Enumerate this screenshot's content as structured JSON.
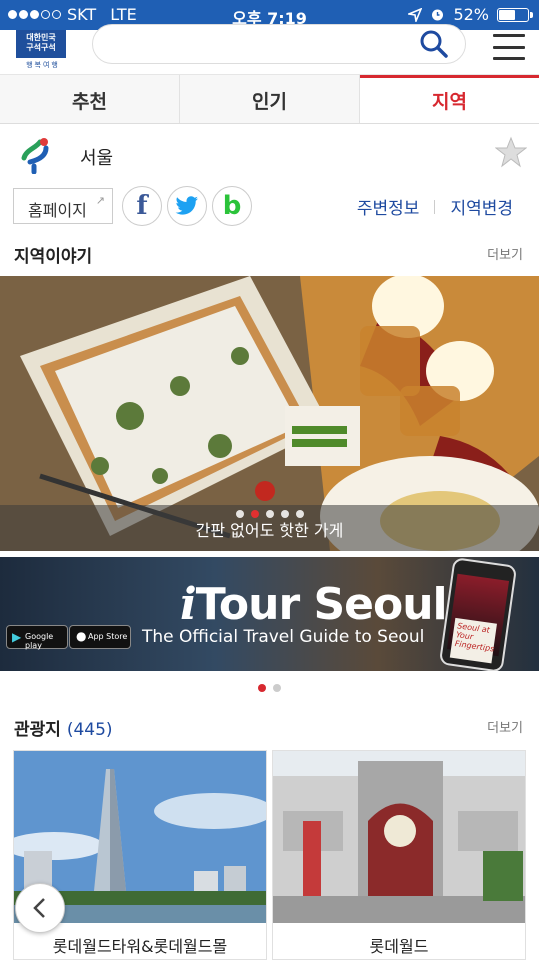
{
  "status_bar": {
    "carrier": "SKT",
    "network": "LTE",
    "time": "오후 7:19",
    "battery": "52%",
    "battery_level": 0.52,
    "signal_bars_filled": 3
  },
  "header": {
    "logo_line1": "대한민국",
    "logo_line2": "구석구석",
    "logo_sub": "행복여행",
    "search_placeholder": ""
  },
  "tabs": [
    {
      "label": "추천",
      "active": false
    },
    {
      "label": "인기",
      "active": false
    },
    {
      "label": "지역",
      "active": true
    }
  ],
  "region": {
    "name": "서울",
    "homepage_label": "홈페이지",
    "social": [
      "facebook-icon",
      "twitter-icon",
      "band-icon"
    ],
    "nearby_label": "주변정보",
    "change_region_label": "지역변경"
  },
  "story_section": {
    "title": "지역이야기",
    "more_label": "더보기",
    "caption": "간판 없어도 핫한 가게",
    "page_count": 5,
    "active_page": 1
  },
  "promo_banner": {
    "brand_i": "i",
    "brand_rest": "Tour Seoul",
    "tagline": "The Official Travel Guide to Seoul",
    "google_play": "Google play",
    "app_store": "App Store",
    "phone_note": "Seoul at Your Fingertips",
    "page_count": 2,
    "active_page": 0
  },
  "attractions_section": {
    "title": "관광지",
    "count": "(445)",
    "more_label": "더보기",
    "items": [
      {
        "name": "롯데월드타워&롯데월드몰"
      },
      {
        "name": "롯데월드"
      }
    ]
  },
  "colors": {
    "status_bar": "#1f5fb4",
    "accent_red": "#d7282f",
    "link_blue": "#1e4aa0"
  }
}
